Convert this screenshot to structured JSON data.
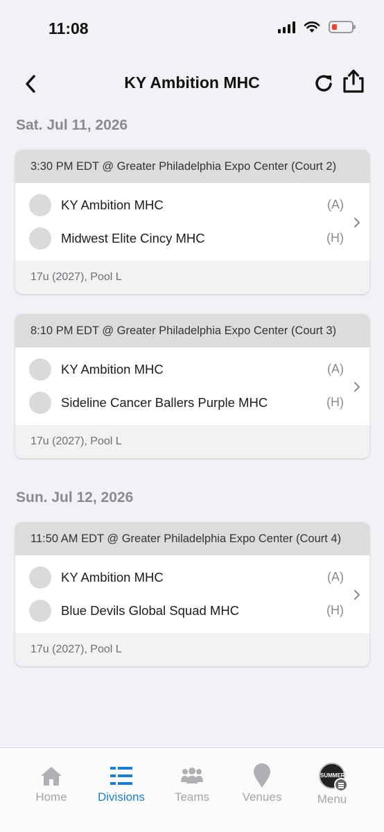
{
  "status_bar": {
    "time": "11:08"
  },
  "header": {
    "title": "KY Ambition MHC"
  },
  "days": [
    {
      "date": "Sat. Jul 11, 2026",
      "games": [
        {
          "info": "3:30 PM EDT @ Greater Philadelphia Expo Center (Court 2)",
          "teams": [
            {
              "name": "KY Ambition MHC",
              "side": "(A)"
            },
            {
              "name": "Midwest Elite Cincy MHC",
              "side": "(H)"
            }
          ],
          "division": "17u (2027), Pool L"
        },
        {
          "info": "8:10 PM EDT @ Greater Philadelphia Expo Center (Court 3)",
          "teams": [
            {
              "name": "KY Ambition MHC",
              "side": "(A)"
            },
            {
              "name": "Sideline Cancer Ballers Purple MHC",
              "side": "(H)"
            }
          ],
          "division": "17u (2027), Pool L"
        }
      ]
    },
    {
      "date": "Sun. Jul 12, 2026",
      "games": [
        {
          "info": "11:50 AM EDT @ Greater Philadelphia Expo Center (Court 4)",
          "teams": [
            {
              "name": "KY Ambition MHC",
              "side": "(A)"
            },
            {
              "name": "Blue Devils Global Squad MHC",
              "side": "(H)"
            }
          ],
          "division": "17u (2027), Pool L"
        }
      ]
    }
  ],
  "tabs": [
    {
      "label": "Home",
      "icon": "home-icon",
      "active": false
    },
    {
      "label": "Divisions",
      "icon": "divisions-icon",
      "active": true
    },
    {
      "label": "Teams",
      "icon": "teams-icon",
      "active": false
    },
    {
      "label": "Venues",
      "icon": "location-pin-icon",
      "active": false
    },
    {
      "label": "Menu",
      "icon": "menu-avatar-icon",
      "active": false
    }
  ],
  "menu_logo_text": "SUMMER",
  "colors": {
    "accent": "#1a7fd4",
    "battery_low": "#ff3b30"
  }
}
